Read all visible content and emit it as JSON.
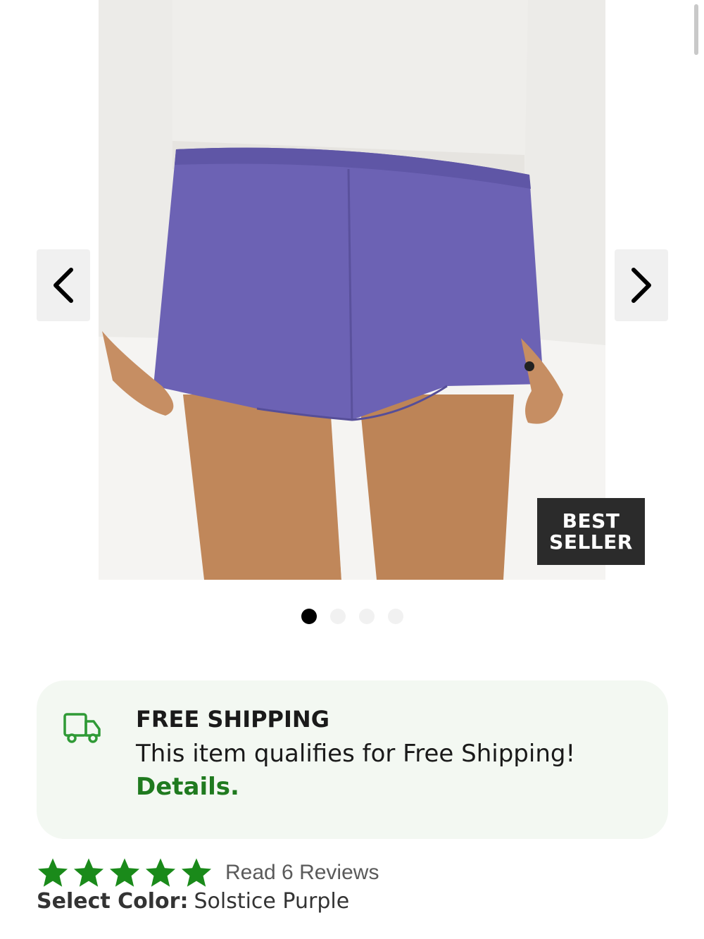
{
  "gallery": {
    "image_alt": "Woman wearing purple shorts and a white long-sleeve top",
    "badge": {
      "line1": "BEST",
      "line2": "SELLER"
    },
    "slide_count": 4,
    "active_slide": 1
  },
  "shipping": {
    "title": "FREE SHIPPING",
    "text": "This item qualifies for Free Shipping!",
    "link": "Details.",
    "accent_color": "#1f7a1f"
  },
  "rating": {
    "stars": 5,
    "star_color": "#1a8a1a",
    "reviews_label": "Read 6 Reviews"
  },
  "color": {
    "label": "Select Color:",
    "value": "Solstice Purple"
  }
}
